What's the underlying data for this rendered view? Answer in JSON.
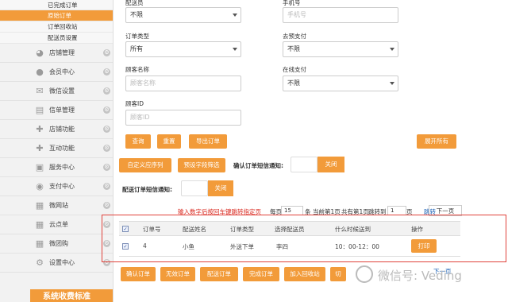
{
  "sidebar": {
    "subitems": [
      {
        "label": "已完成订单",
        "active": false
      },
      {
        "label": "原始订单",
        "active": true
      },
      {
        "label": "订单回收站",
        "active": false
      },
      {
        "label": "配送员设置",
        "active": false
      }
    ],
    "items": [
      {
        "label": "店铺管理",
        "icon": "pie-chart-icon"
      },
      {
        "label": "会员中心",
        "icon": "member-icon"
      },
      {
        "label": "微信设置",
        "icon": "mail-icon"
      },
      {
        "label": "信单管理",
        "icon": "inbox-icon"
      },
      {
        "label": "店铺功能",
        "icon": "plus-icon"
      },
      {
        "label": "互动功能",
        "icon": "plus-icon"
      },
      {
        "label": "服务中心",
        "icon": "chat-icon"
      },
      {
        "label": "支付中心",
        "icon": "wallet-icon"
      },
      {
        "label": "微网站",
        "icon": "grid-icon"
      },
      {
        "label": "云点单",
        "icon": "grid-icon"
      },
      {
        "label": "微团购",
        "icon": "grid-icon"
      },
      {
        "label": "设置中心",
        "icon": "gear-icon"
      }
    ],
    "bottom_label": "系统收费标准"
  },
  "filters": {
    "top_left_label": "配送员",
    "top_left_value": "不限",
    "top_right_label": "手机号",
    "top_right_placeholder": "手机号",
    "order_type_label": "订单类型",
    "order_type_value": "所有",
    "paid_label": "去预支付",
    "paid_value": "不限",
    "customer_name_label": "顾客名称",
    "customer_name_placeholder": "顾客名称",
    "online_pay_label": "在线支付",
    "online_pay_value": "不限",
    "customer_id_label": "顾客ID",
    "customer_id_placeholder": "顾客ID"
  },
  "actions": {
    "search": "查询",
    "reset": "重置",
    "export": "导出订单",
    "expand_all": "展开所有",
    "custom_order": "自定义应序列",
    "preset_filter": "预设字段筛选",
    "confirm_sms_label": "确认订单短信通知:",
    "toggle_off": "关闭",
    "dispatch_sms_label": "配送订单短信通知:"
  },
  "pagination": {
    "hint": "输入数字后按回车键跳转指定页",
    "per_page_prefix": "每页",
    "per_page_value": "15",
    "per_page_suffix": "条",
    "current": "当前第1页",
    "total": "共有第1页",
    "jump_prefix": "跳转到",
    "jump_value": "1",
    "jump_suffix": "页",
    "jump_link": "跳转",
    "next": "下一页",
    "next_bottom": "下一页"
  },
  "table": {
    "headers": [
      "订单号",
      "配送姓名",
      "订单类型",
      "选择配送员",
      "什么时候送到",
      "操作"
    ],
    "rows": [
      {
        "id": "4",
        "name": "小鱼",
        "type": "外送下单",
        "courier": "李四",
        "time": "10：00-12：00",
        "action": "打印"
      }
    ]
  },
  "bottom_buttons": [
    "确认订单",
    "无效订单",
    "配送订单",
    "完成订单",
    "加入回收站",
    "切"
  ],
  "watermark": "微信号: Veding",
  "colors": {
    "accent": "#f29b3a",
    "danger": "#d9261c",
    "link": "#1a5fb4"
  }
}
